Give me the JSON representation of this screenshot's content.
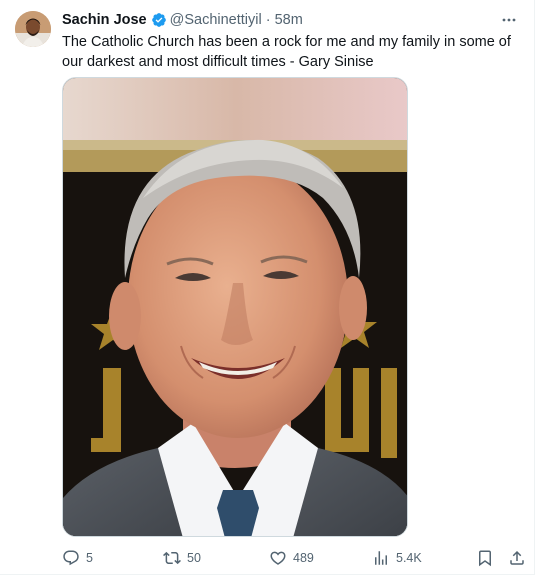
{
  "tweet": {
    "author_name": "Sachin Jose",
    "handle": "@Sachinettiyil",
    "separator": "·",
    "time": "58m",
    "text": "The Catholic Church has been a rock for me and my family in some of our darkest and most difficult times - Gary Sinise",
    "verified": true
  },
  "actions": {
    "replies": "5",
    "retweets": "50",
    "likes": "489",
    "views": "5.4K"
  },
  "icons": {
    "verified": "verified-badge-icon",
    "more": "more-horizontal-icon",
    "reply": "reply-icon",
    "retweet": "retweet-icon",
    "like": "heart-icon",
    "views": "views-chart-icon",
    "bookmark": "bookmark-icon",
    "share": "share-icon"
  },
  "colors": {
    "accent": "#1d9bf0",
    "secondary_text": "#536471",
    "primary_text": "#0f1419"
  }
}
